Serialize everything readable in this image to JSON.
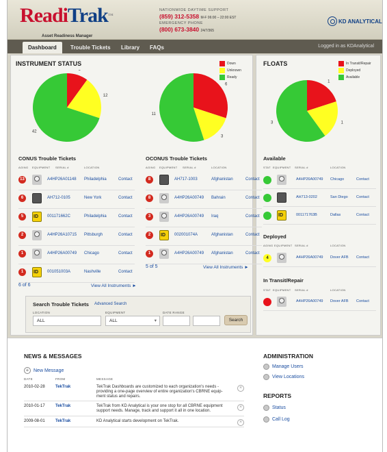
{
  "header": {
    "logo_r": "Readi",
    "logo_t": "Trak",
    "logo_tm": "™",
    "tagline": "Asset Readiness Manager",
    "support_label": "NATIONWIDE DAYTIME SUPPORT",
    "support_phone": "(859) 312-5358",
    "support_hours": "M-F 06:00 – 22:00 EST",
    "emergency_label": "EMERGENCY PHONE",
    "emergency_phone": "(800) 673-3840",
    "emergency_hours": "24/7/365",
    "brand": "KD ANALYTICAL"
  },
  "nav": {
    "tabs": [
      "Dashboard",
      "Trouble Tickets",
      "Library",
      "FAQs"
    ],
    "login": "Logged in as KDAnalytical"
  },
  "status": {
    "title": "INSTRUMENT STATUS",
    "legend": [
      {
        "label": "Down",
        "color": "#e8131b"
      },
      {
        "label": "Unknown",
        "color": "#ffff22"
      },
      {
        "label": "Ready",
        "color": "#36c936"
      }
    ]
  },
  "floats": {
    "title": "FLOATS",
    "legend": [
      {
        "label": "In Transit/Repair",
        "color": "#e8131b"
      },
      {
        "label": "Deployed",
        "color": "#ffff22"
      },
      {
        "label": "Available",
        "color": "#36c936"
      }
    ]
  },
  "chart_data": [
    {
      "type": "pie",
      "categories": [
        "Down",
        "Unknown",
        "Ready"
      ],
      "values": [
        6,
        12,
        42
      ]
    },
    {
      "type": "pie",
      "categories": [
        "Down",
        "Unknown",
        "Ready"
      ],
      "values": [
        6,
        3,
        11
      ]
    },
    {
      "type": "pie",
      "categories": [
        "In Transit/Repair",
        "Deployed",
        "Available"
      ],
      "values": [
        1,
        1,
        3
      ]
    }
  ],
  "conus": {
    "title": "CONUS Trouble Tickets",
    "cols": [
      "AGING",
      "EQUIPMENT",
      "SERIAL #",
      "LOCATION"
    ],
    "rows": [
      {
        "age": "13",
        "icon": "mask",
        "serial": "A4HP26A01148",
        "loc": "Philadelphia",
        "action": "Contact"
      },
      {
        "age": "6",
        "icon": "box",
        "serial": "AH712-0105",
        "loc": "New York",
        "action": "Contact"
      },
      {
        "age": "5",
        "icon": "id",
        "serial": "001171662C",
        "loc": "Philadelphia",
        "action": "Contact"
      },
      {
        "age": "2",
        "icon": "mask",
        "serial": "A4HP26A10715",
        "loc": "Pittsburgh",
        "action": "Contact"
      },
      {
        "age": "1",
        "icon": "mask",
        "serial": "A4HP26A00749",
        "loc": "Chicago",
        "action": "Contact"
      },
      {
        "age": "1",
        "icon": "id",
        "serial": "001051003A",
        "loc": "Nashville",
        "action": "Contact"
      }
    ],
    "pager": "6 of 6",
    "view_all": "View All Instruments ►"
  },
  "oconus": {
    "title": "OCONUS Trouble Tickets",
    "cols": [
      "AGING",
      "EQUIPMENT",
      "SERIAL #",
      "LOCATION"
    ],
    "rows": [
      {
        "age": "8",
        "icon": "box",
        "serial": "AH717-1003",
        "loc": "Afghanistan",
        "action": "Contact"
      },
      {
        "age": "8",
        "icon": "mask",
        "serial": "A4HP26A00749",
        "loc": "Bahrain",
        "action": "Contact"
      },
      {
        "age": "3",
        "icon": "mask",
        "serial": "A4HP26A00749",
        "loc": "Iraq",
        "action": "Contact"
      },
      {
        "age": "2",
        "icon": "id",
        "serial": "002001074A",
        "loc": "Afghanistan",
        "action": "Contact"
      },
      {
        "age": "1",
        "icon": "mask",
        "serial": "A4HP26A00749",
        "loc": "Afghanistan",
        "action": "Contact"
      }
    ],
    "pager": "5 of 5",
    "view_all": "View All Instruments ►"
  },
  "search": {
    "title": "Search Trouble Tickets",
    "advanced": "Advanced Search",
    "location_label": "LOCATION",
    "location": "ALL",
    "equipment_label": "EQUIPMENT",
    "equipment": "ALL",
    "date_label": "DATE RANGE",
    "button": "Search"
  },
  "available": {
    "title": "Available",
    "cols": [
      "STAT",
      "EQUIPMENT",
      "SERIAL #",
      "LOCATION"
    ],
    "rows": [
      {
        "icon": "mask",
        "serial": "A4HP26A00749",
        "loc": "Chicago",
        "action": "Contact"
      },
      {
        "icon": "box",
        "serial": "AH713-0202",
        "loc": "San Diego",
        "action": "Contact"
      },
      {
        "icon": "id",
        "serial": "001171763B",
        "loc": "Dallas",
        "action": "Contact"
      }
    ]
  },
  "deployed": {
    "title": "Deployed",
    "cols": [
      "AGING",
      "EQUIPMENT",
      "SERIAL #",
      "LOCATION"
    ],
    "rows": [
      {
        "age": "4",
        "icon": "mask",
        "serial": "A4HP26A00749",
        "loc": "Dover AFB",
        "action": "Contact"
      }
    ]
  },
  "transit": {
    "title": "In Transit/Repair",
    "cols": [
      "STAT",
      "EQUIPMENT",
      "SERIAL #",
      "LOCATION"
    ],
    "rows": [
      {
        "icon": "mask",
        "serial": "A4HP26A00749",
        "loc": "Dover AFB",
        "action": "Contact"
      }
    ]
  },
  "news": {
    "title": "NEWS & MESSAGES",
    "new_message": "New Message",
    "cols": [
      "DATE",
      "FROM",
      "MESSAGE"
    ],
    "rows": [
      {
        "date": "2010-02-28",
        "from": "TekTrak",
        "msg": "TekTrak Dashboards are customized to each organization's needs - providing a one-page overview of entire organization's CBRNE equip-ment status and repairs."
      },
      {
        "date": "2010-01-17",
        "from": "TekTrak",
        "msg": "TekTrak from KD Analytical is your one stop for all CBRNE equipment support needs. Manage, track and support it all in one location."
      },
      {
        "date": "2009-08-01",
        "from": "TekTrak",
        "msg": "KD Analytical starts development on TekTrak."
      }
    ]
  },
  "admin": {
    "title": "ADMINISTRATION",
    "items": [
      "Manage Users",
      "View Locations"
    ]
  },
  "reports": {
    "title": "REPORTS",
    "items": [
      "Status",
      "Call Log"
    ]
  }
}
